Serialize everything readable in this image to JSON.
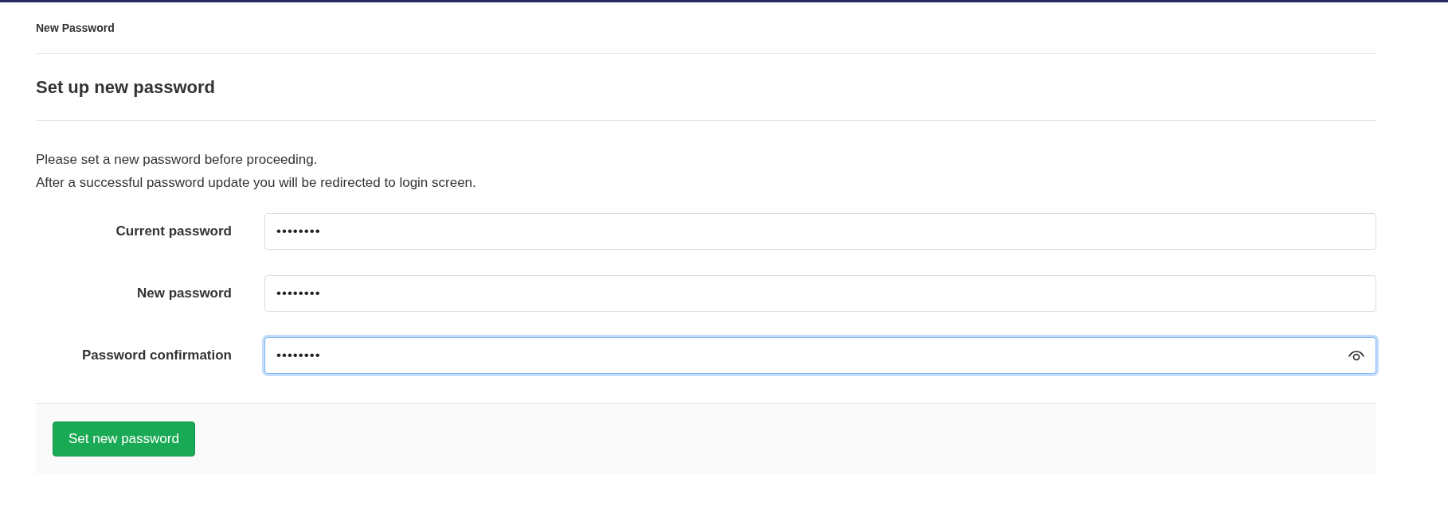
{
  "page_title": "New Password",
  "heading": "Set up new password",
  "intro": [
    "Please set a new password before proceeding.",
    "After a successful password update you will be redirected to login screen."
  ],
  "fields": [
    {
      "label": "Current password",
      "value": "••••••••",
      "focused": false,
      "reveal_icon": false
    },
    {
      "label": "New password",
      "value": "••••••••",
      "focused": false,
      "reveal_icon": false
    },
    {
      "label": "Password confirmation",
      "value": "••••••••",
      "focused": true,
      "reveal_icon": true
    }
  ],
  "submit_button": "Set new password"
}
